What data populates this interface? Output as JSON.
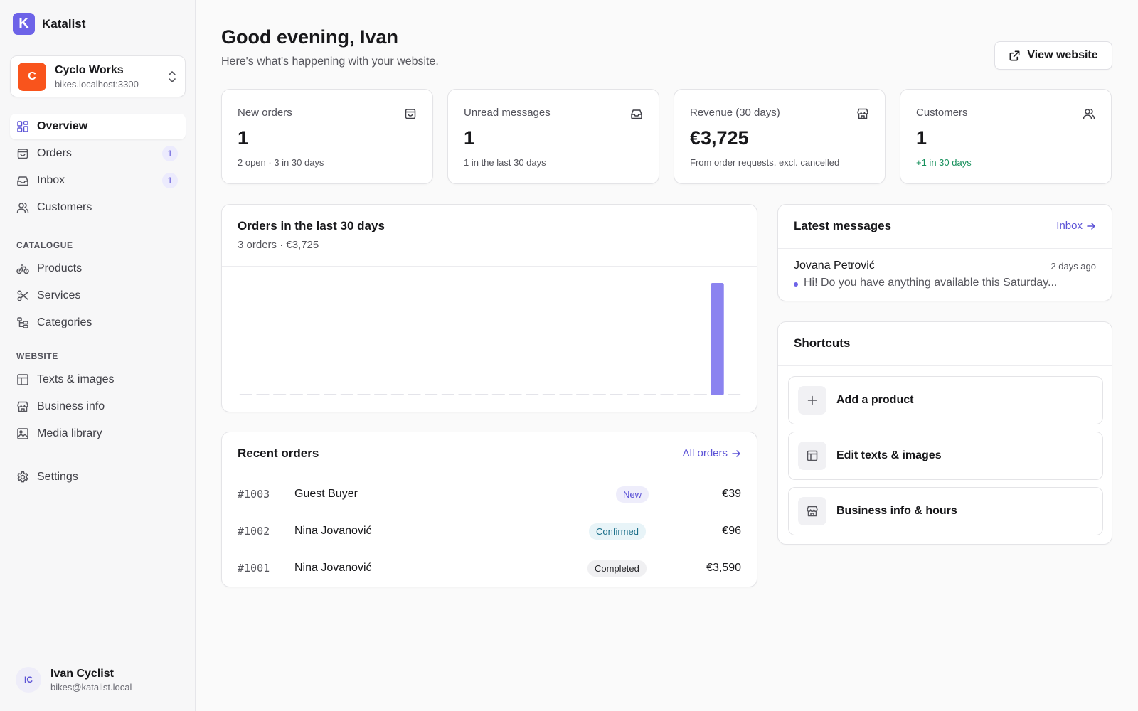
{
  "brand": {
    "logo_letter": "K",
    "name": "Katalist",
    "color": "#6d63e8"
  },
  "site": {
    "initial": "C",
    "name": "Cyclo Works",
    "host": "bikes.localhost:3300",
    "color": "#f9541c"
  },
  "nav": {
    "main": [
      {
        "label": "Overview",
        "icon": "grid-icon",
        "active": true
      },
      {
        "label": "Orders",
        "icon": "bag-icon",
        "badge": "1"
      },
      {
        "label": "Inbox",
        "icon": "inbox-icon",
        "badge": "1"
      },
      {
        "label": "Customers",
        "icon": "users-icon"
      }
    ],
    "catalogue_title": "CATALOGUE",
    "catalogue": [
      {
        "label": "Products",
        "icon": "bike-icon"
      },
      {
        "label": "Services",
        "icon": "scissors-icon"
      },
      {
        "label": "Categories",
        "icon": "tree-icon"
      }
    ],
    "website_title": "WEBSITE",
    "website": [
      {
        "label": "Texts & images",
        "icon": "layout-icon"
      },
      {
        "label": "Business info",
        "icon": "store-icon"
      },
      {
        "label": "Media library",
        "icon": "image-icon"
      }
    ],
    "settings": {
      "label": "Settings",
      "icon": "gear-icon"
    }
  },
  "user": {
    "initials": "IC",
    "name": "Ivan Cyclist",
    "email": "bikes@katalist.local"
  },
  "header": {
    "greeting": "Good evening, Ivan",
    "subtitle": "Here's what's happening with your website.",
    "view_website": "View website"
  },
  "stats": [
    {
      "label": "New orders",
      "value": "1",
      "sub": "2 open · 3 in 30 days",
      "icon": "bag-icon"
    },
    {
      "label": "Unread messages",
      "value": "1",
      "sub": "1 in the last 30 days",
      "icon": "inbox-icon"
    },
    {
      "label": "Revenue (30 days)",
      "value": "€3,725",
      "sub": "From order requests, excl. cancelled",
      "icon": "store-icon"
    },
    {
      "label": "Customers",
      "value": "1",
      "sub": "+1 in 30 days",
      "icon": "users-icon"
    }
  ],
  "orders_chart": {
    "title": "Orders in the last 30 days",
    "subtitle": "3 orders · €3,725"
  },
  "chart_data": {
    "type": "bar",
    "days": 30,
    "values": [
      0,
      0,
      0,
      0,
      0,
      0,
      0,
      0,
      0,
      0,
      0,
      0,
      0,
      0,
      0,
      0,
      0,
      0,
      0,
      0,
      0,
      0,
      0,
      0,
      0,
      0,
      0,
      0,
      3725,
      0
    ],
    "bar_color": "#8b83f0",
    "empty_color": "#e4e4ea",
    "grid": false
  },
  "recent_orders": {
    "title": "Recent orders",
    "link": "All orders",
    "rows": [
      {
        "id": "#1003",
        "customer": "Guest Buyer",
        "status": "New",
        "total": "€39"
      },
      {
        "id": "#1002",
        "customer": "Nina Jovanović",
        "status": "Confirmed",
        "total": "€96"
      },
      {
        "id": "#1001",
        "customer": "Nina Jovanović",
        "status": "Completed",
        "total": "€3,590"
      }
    ]
  },
  "messages": {
    "title": "Latest messages",
    "link": "Inbox",
    "items": [
      {
        "from": "Jovana Petrović",
        "time": "2 days ago",
        "preview": "Hi! Do you have anything available this Saturday..."
      }
    ]
  },
  "shortcuts": {
    "title": "Shortcuts",
    "items": [
      {
        "label": "Add a product",
        "icon": "plus-icon"
      },
      {
        "label": "Edit texts & images",
        "icon": "layout-icon"
      },
      {
        "label": "Business info & hours",
        "icon": "store-icon"
      }
    ]
  }
}
